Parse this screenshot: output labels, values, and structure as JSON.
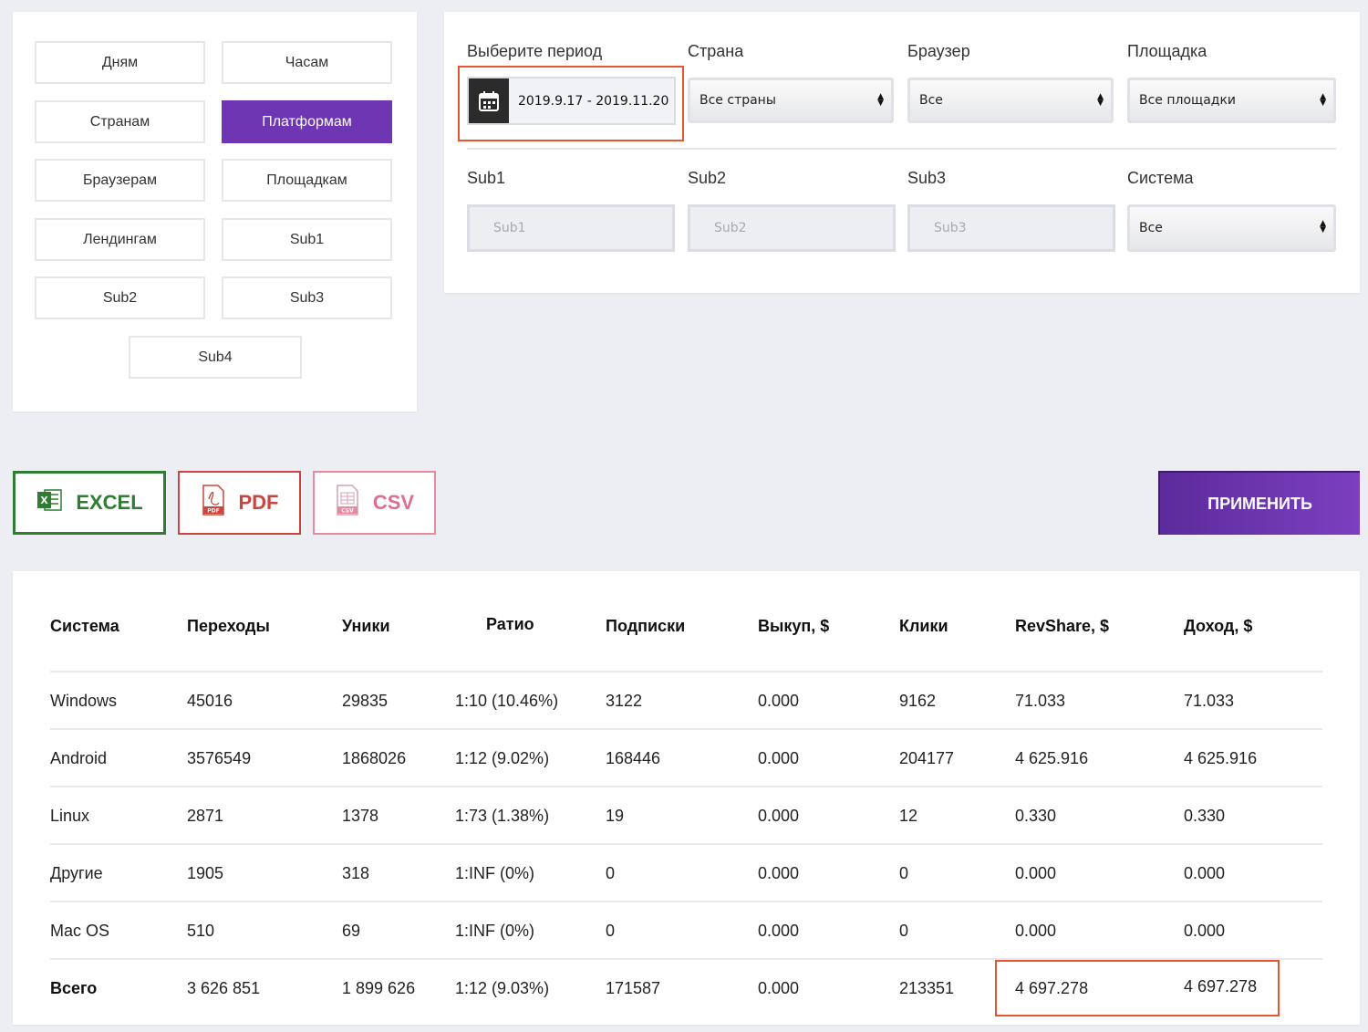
{
  "grouping": {
    "buttons": [
      {
        "label": "Дням",
        "active": false
      },
      {
        "label": "Часам",
        "active": false
      },
      {
        "label": "Странам",
        "active": false
      },
      {
        "label": "Платформам",
        "active": true
      },
      {
        "label": "Браузерам",
        "active": false
      },
      {
        "label": "Площадкам",
        "active": false
      },
      {
        "label": "Лендингам",
        "active": false
      },
      {
        "label": "Sub1",
        "active": false
      },
      {
        "label": "Sub2",
        "active": false
      },
      {
        "label": "Sub3",
        "active": false
      },
      {
        "label": "Sub4",
        "active": false
      }
    ]
  },
  "filters": {
    "period": {
      "label": "Выберите период",
      "value": "2019.9.17 - 2019.11.20"
    },
    "country": {
      "label": "Страна",
      "value": "Все страны"
    },
    "browser": {
      "label": "Браузер",
      "value": "Все"
    },
    "site": {
      "label": "Площадка",
      "value": "Все площадки"
    },
    "sub1": {
      "label": "Sub1",
      "placeholder": "Sub1"
    },
    "sub2": {
      "label": "Sub2",
      "placeholder": "Sub2"
    },
    "sub3": {
      "label": "Sub3",
      "placeholder": "Sub3"
    },
    "system": {
      "label": "Система",
      "value": "Все"
    }
  },
  "export": {
    "excel": "EXCEL",
    "pdf": "PDF",
    "csv": "CSV",
    "pdf_icon_text": "PDF",
    "csv_icon_text": "CSV"
  },
  "apply_label": "ПРИМЕНИТЬ",
  "table": {
    "headers": [
      "Система",
      "Переходы",
      "Уники",
      "Ратио",
      "Подписки",
      "Выкуп, $",
      "Клики",
      "RevShare, $",
      "Доход, $"
    ],
    "rows": [
      [
        "Windows",
        "45016",
        "29835",
        "1:10 (10.46%)",
        "3122",
        "0.000",
        "9162",
        "71.033",
        "71.033"
      ],
      [
        "Android",
        "3576549",
        "1868026",
        "1:12 (9.02%)",
        "168446",
        "0.000",
        "204177",
        "4 625.916",
        "4 625.916"
      ],
      [
        "Linux",
        "2871",
        "1378",
        "1:73 (1.38%)",
        "19",
        "0.000",
        "12",
        "0.330",
        "0.330"
      ],
      [
        "Другие",
        "1905",
        "318",
        "1:INF (0%)",
        "0",
        "0.000",
        "0",
        "0.000",
        "0.000"
      ],
      [
        "Mac OS",
        "510",
        "69",
        "1:INF (0%)",
        "0",
        "0.000",
        "0",
        "0.000",
        "0.000"
      ]
    ],
    "total": [
      "Всего",
      "3 626 851",
      "1 899 626",
      "1:12 (9.03%)",
      "171587",
      "0.000",
      "213351",
      "4 697.278",
      "4 697.278"
    ]
  },
  "colors": {
    "accent": "#6f36b4",
    "highlight": "#e4572e",
    "excel": "#2e7d32",
    "pdf": "#c9453f",
    "csv": "#e06d8f"
  }
}
